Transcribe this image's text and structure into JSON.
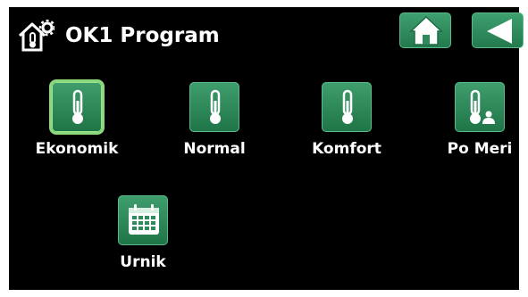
{
  "header": {
    "title": "OK1 Program",
    "title_icon": "house-thermometer-gear-icon",
    "home_button_icon": "home-icon",
    "back_button_icon": "back-arrow-icon"
  },
  "program_options": [
    {
      "label": "Ekonomik",
      "icon": "thermometer-icon",
      "selected": true
    },
    {
      "label": "Normal",
      "icon": "thermometer-icon",
      "selected": false
    },
    {
      "label": "Komfort",
      "icon": "thermometer-icon",
      "selected": false
    },
    {
      "label": "Po Meri",
      "icon": "thermometer-user-icon",
      "selected": false
    },
    {
      "label": "Urnik",
      "icon": "calendar-icon",
      "selected": false
    }
  ],
  "colors": {
    "background": "#000000",
    "button_green": "#2e8a5a",
    "selected_outline": "#8bd97c",
    "text": "#ffffff"
  }
}
